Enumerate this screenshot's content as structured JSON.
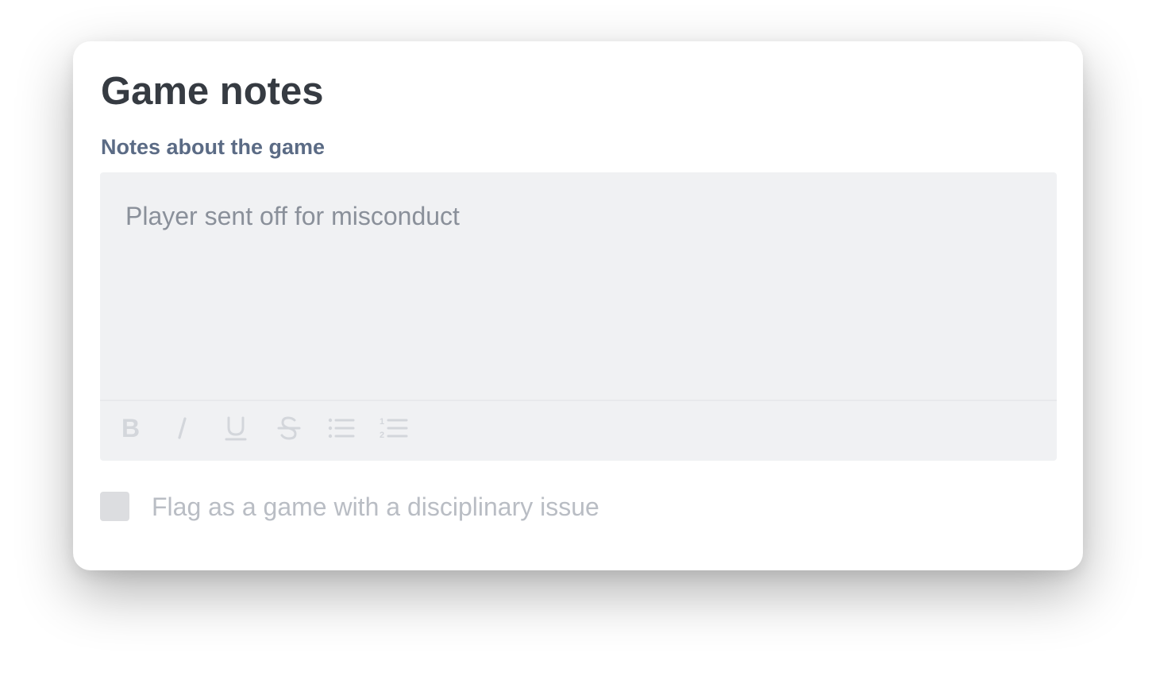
{
  "card": {
    "title": "Game notes",
    "notes_label": "Notes about the game",
    "notes_value": "Player sent off for misconduct"
  },
  "toolbar": {
    "items": [
      {
        "name": "bold",
        "icon": "bold-icon"
      },
      {
        "name": "italic",
        "icon": "italic-icon"
      },
      {
        "name": "underline",
        "icon": "underline-icon"
      },
      {
        "name": "strikethrough",
        "icon": "strikethrough-icon"
      },
      {
        "name": "bulleted-list",
        "icon": "bulleted-list-icon"
      },
      {
        "name": "numbered-list",
        "icon": "numbered-list-icon"
      }
    ]
  },
  "flag": {
    "label": "Flag as a game with a disciplinary issue",
    "checked": false
  },
  "colors": {
    "title": "#363b42",
    "label": "#5b6b85",
    "editor_background": "#f0f1f3",
    "editor_text": "#8a909a",
    "toolbar_icon": "#d3d6db",
    "checkbox": "#dcdde0",
    "checkbox_label": "#b9bdc4"
  }
}
